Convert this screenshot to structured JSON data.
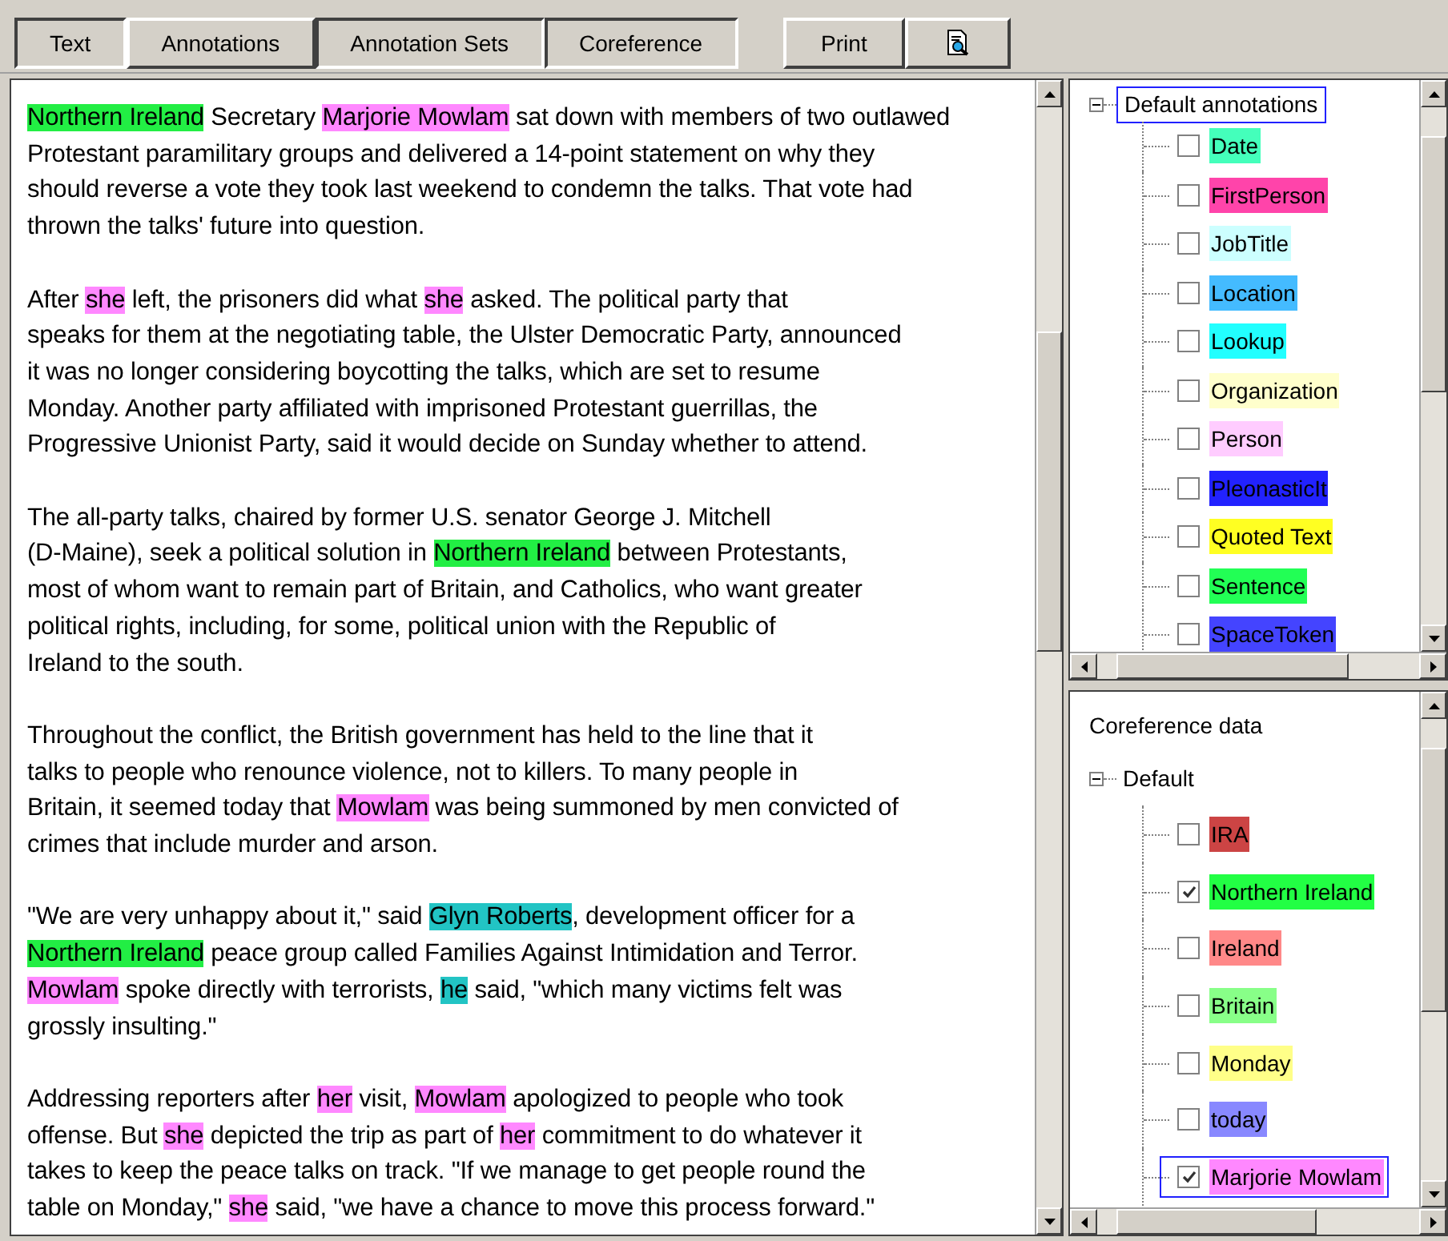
{
  "toolbar": {
    "tabs": [
      {
        "label": "Text",
        "selected": true
      },
      {
        "label": "Annotations",
        "selected": false
      },
      {
        "label": "Annotation Sets",
        "selected": true
      },
      {
        "label": "Coreference",
        "selected": true
      }
    ],
    "print_button": "Print"
  },
  "document": {
    "paragraphs": [
      [
        [
          {
            "text": "Northern Ireland",
            "color": "#22ee44"
          },
          {
            "text": " Secretary "
          },
          {
            "text": "Marjorie Mowlam",
            "color": "#ff88ff"
          },
          {
            "text": " sat down with members of two outlawed"
          }
        ],
        [
          {
            "text": "Protestant paramilitary groups and delivered a 14-point statement on why they"
          }
        ],
        [
          {
            "text": "should reverse a vote they took last weekend to condemn the talks. That vote had"
          }
        ],
        [
          {
            "text": "thrown the talks' future into question."
          }
        ]
      ],
      [
        [
          {
            "text": "After "
          },
          {
            "text": "she",
            "color": "#ff88ff"
          },
          {
            "text": " left, the prisoners did what "
          },
          {
            "text": "she",
            "color": "#ff88ff"
          },
          {
            "text": " asked. The political party that"
          }
        ],
        [
          {
            "text": "speaks for them at the negotiating table, the Ulster Democratic Party, announced"
          }
        ],
        [
          {
            "text": "it was no longer considering boycotting the talks, which are set to resume"
          }
        ],
        [
          {
            "text": "Monday. Another party affiliated with imprisoned Protestant guerrillas, the"
          }
        ],
        [
          {
            "text": "Progressive Unionist Party, said it would decide on Sunday whether to attend."
          }
        ]
      ],
      [
        [
          {
            "text": "The all-party talks, chaired by former U.S. senator George J. Mitchell"
          }
        ],
        [
          {
            "text": "(D-Maine), seek a political solution in "
          },
          {
            "text": "Northern Ireland",
            "color": "#22ee44"
          },
          {
            "text": " between Protestants,"
          }
        ],
        [
          {
            "text": "most of whom want to remain part of Britain, and Catholics, who want greater"
          }
        ],
        [
          {
            "text": "political rights, including, for some, political union with the Republic of"
          }
        ],
        [
          {
            "text": "Ireland to the south."
          }
        ]
      ],
      [
        [
          {
            "text": "Throughout the conflict, the British government has held to the line that it"
          }
        ],
        [
          {
            "text": "talks to people who renounce violence, not to killers. To many people in"
          }
        ],
        [
          {
            "text": "Britain, it seemed today that "
          },
          {
            "text": "Mowlam",
            "color": "#ff88ff"
          },
          {
            "text": " was being summoned by men convicted of"
          }
        ],
        [
          {
            "text": "crimes that include murder and arson."
          }
        ]
      ],
      [
        [
          {
            "text": "\"We are very unhappy about it,\" said "
          },
          {
            "text": "Glyn Roberts",
            "color": "#22c4c4"
          },
          {
            "text": ", development officer for a"
          }
        ],
        [
          {
            "text": "Northern Ireland",
            "color": "#22ee44"
          },
          {
            "text": " peace group called Families Against Intimidation and Terror."
          }
        ],
        [
          {
            "text": "Mowlam",
            "color": "#ff88ff"
          },
          {
            "text": " spoke directly with terrorists, "
          },
          {
            "text": "he",
            "color": "#22c4c4"
          },
          {
            "text": " said, \"which many victims felt was"
          }
        ],
        [
          {
            "text": "grossly insulting.\""
          }
        ]
      ],
      [
        [
          {
            "text": "Addressing reporters after "
          },
          {
            "text": "her",
            "color": "#ff88ff"
          },
          {
            "text": " visit, "
          },
          {
            "text": "Mowlam",
            "color": "#ff88ff"
          },
          {
            "text": " apologized to people who took"
          }
        ],
        [
          {
            "text": "offense. But "
          },
          {
            "text": "she",
            "color": "#ff88ff"
          },
          {
            "text": " depicted the trip as part of "
          },
          {
            "text": "her",
            "color": "#ff88ff"
          },
          {
            "text": " commitment to do whatever it"
          }
        ],
        [
          {
            "text": "takes to keep the peace talks on track. \"If we manage to get people round the"
          }
        ],
        [
          {
            "text": "table on Monday,\" "
          },
          {
            "text": "she",
            "color": "#ff88ff"
          },
          {
            "text": " said, \"we have a chance to move this process forward.\""
          }
        ]
      ]
    ]
  },
  "annotation_sets": {
    "root": {
      "label": "Default annotations",
      "selected": true,
      "expanded": true
    },
    "items": [
      {
        "label": "Date",
        "checked": false,
        "color": "#44ffbb"
      },
      {
        "label": "FirstPerson",
        "checked": false,
        "color": "#ff44aa"
      },
      {
        "label": "JobTitle",
        "checked": false,
        "color": "#ccffff"
      },
      {
        "label": "Location",
        "checked": false,
        "color": "#44bbff"
      },
      {
        "label": "Lookup",
        "checked": false,
        "color": "#22ffff"
      },
      {
        "label": "Organization",
        "checked": false,
        "color": "#ffffcc"
      },
      {
        "label": "Person",
        "checked": false,
        "color": "#ffccff"
      },
      {
        "label": "PleonasticIt",
        "checked": false,
        "color": "#2222ff"
      },
      {
        "label": "Quoted Text",
        "checked": false,
        "color": "#ffff22"
      },
      {
        "label": "Sentence",
        "checked": false,
        "color": "#22ff55"
      },
      {
        "label": "SpaceToken",
        "checked": false,
        "color": "#4444ff"
      }
    ]
  },
  "coreference": {
    "title": "Coreference data",
    "root": {
      "label": "Default",
      "expanded": true
    },
    "items": [
      {
        "label": "IRA",
        "checked": false,
        "selected": false,
        "color": "#cc4444"
      },
      {
        "label": "Northern Ireland",
        "checked": true,
        "selected": false,
        "color": "#22ff44"
      },
      {
        "label": "Ireland",
        "checked": false,
        "selected": false,
        "color": "#ff8888"
      },
      {
        "label": "Britain",
        "checked": false,
        "selected": false,
        "color": "#88ff88"
      },
      {
        "label": "Monday",
        "checked": false,
        "selected": false,
        "color": "#ffff88"
      },
      {
        "label": "today",
        "checked": false,
        "selected": false,
        "color": "#8888ff"
      },
      {
        "label": "Marjorie Mowlam",
        "checked": true,
        "selected": true,
        "color": "#ff88ff"
      }
    ]
  }
}
